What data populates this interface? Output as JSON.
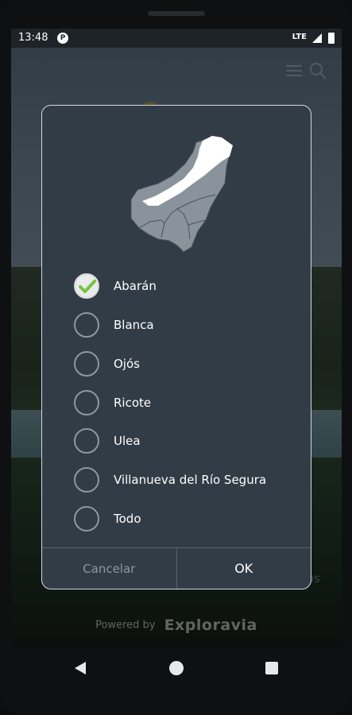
{
  "status_bar": {
    "time": "13:48",
    "notification_icon": "app-notification-icon",
    "network": "LTE",
    "signal_icon": "signal-icon",
    "battery_icon": "battery-icon"
  },
  "background": {
    "partial_text": "os",
    "powered_by": "Powered by",
    "brand": "Exploravia"
  },
  "dialog": {
    "map_icon": "region-map-icon",
    "options": [
      {
        "label": "Abarán",
        "checked": true
      },
      {
        "label": "Blanca",
        "checked": false
      },
      {
        "label": "Ojós",
        "checked": false
      },
      {
        "label": "Ricote",
        "checked": false
      },
      {
        "label": "Ulea",
        "checked": false
      },
      {
        "label": "Villanueva del Río Segura",
        "checked": false
      },
      {
        "label": "Todo",
        "checked": false
      }
    ],
    "cancel_label": "Cancelar",
    "ok_label": "OK"
  },
  "colors": {
    "dialog_bg": "#323c47",
    "check_accent": "#7ac23a",
    "map_fill": "#8a939b",
    "map_highlight": "#ffffff"
  },
  "nav_bar": {
    "back_icon": "back-icon",
    "home_icon": "home-icon",
    "recents_icon": "recents-icon"
  }
}
